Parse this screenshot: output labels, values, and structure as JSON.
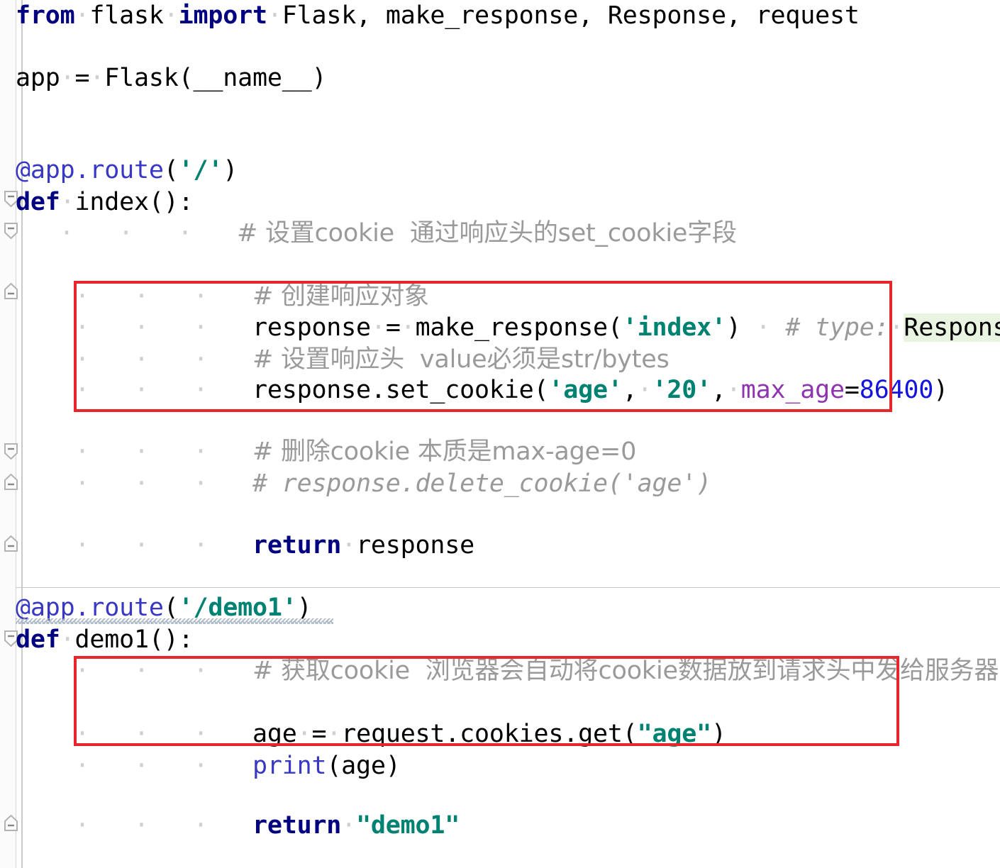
{
  "editor": {
    "language": "python",
    "filename_context": "flask cookie demo",
    "background": "#ffffff",
    "gutter_background": "#fbfbfb",
    "annotation_color": "#e8252b",
    "highlight_background": "#e9f4e1"
  },
  "code_lines": [
    {
      "id": "line-1",
      "text": "from flask import Flask, make_response, Response, request",
      "tokens": [
        {
          "t": "from",
          "c": "kw"
        },
        {
          "t": " ",
          "c": "dot"
        },
        {
          "t": "flask",
          "c": "plain"
        },
        {
          "t": " ",
          "c": "dot"
        },
        {
          "t": "import",
          "c": "kw"
        },
        {
          "t": " ",
          "c": "dot"
        },
        {
          "t": "Flask, make_response, Response, request",
          "c": "plain"
        }
      ]
    },
    {
      "id": "line-3",
      "text": "app = Flask(__name__)",
      "tokens": [
        {
          "t": "app",
          "c": "plain"
        },
        {
          "t": " ",
          "c": "dot"
        },
        {
          "t": "=",
          "c": "plain"
        },
        {
          "t": " ",
          "c": "dot"
        },
        {
          "t": "Flask(__name__)",
          "c": "plain"
        }
      ]
    },
    {
      "id": "line-6",
      "text": "@app.route('/')",
      "tokens": [
        {
          "t": "@app",
          "c": "deco"
        },
        {
          "t": ".",
          "c": "decodot"
        },
        {
          "t": "route",
          "c": "deco"
        },
        {
          "t": "(",
          "c": "plain"
        },
        {
          "t": "'/'",
          "c": "str"
        },
        {
          "t": ")",
          "c": "plain"
        }
      ]
    },
    {
      "id": "line-7",
      "text": "def index():",
      "tokens": [
        {
          "t": "def",
          "c": "kw"
        },
        {
          "t": " ",
          "c": "dot"
        },
        {
          "t": "index():",
          "c": "plain"
        }
      ]
    },
    {
      "id": "line-8",
      "text": "    # 设置cookie  通过响应头的set_cookie字段",
      "comment": true
    },
    {
      "id": "line-10",
      "text": "    # 创建响应对象",
      "comment": true
    },
    {
      "id": "line-11",
      "text": "    response = make_response('index')  # type: Response"
    },
    {
      "id": "line-12",
      "text": "    # 设置响应头  value必须是str/bytes",
      "comment": true
    },
    {
      "id": "line-13",
      "text": "    response.set_cookie('age', '20', max_age=86400)"
    },
    {
      "id": "line-15",
      "text": "    # 删除cookie 本质是max-age=0",
      "comment": true
    },
    {
      "id": "line-16",
      "text": "    # response.delete_cookie('age')",
      "comment": true
    },
    {
      "id": "line-18",
      "text": "    return response"
    },
    {
      "id": "line-20",
      "text": "@app.route('/demo1')"
    },
    {
      "id": "line-21",
      "text": "def demo1():"
    },
    {
      "id": "line-22",
      "text": "    # 获取cookie  浏览器会自动将cookie数据放到请求头中发给服务器",
      "comment": true
    },
    {
      "id": "line-24",
      "text": "    age = request.cookies.get(\"age\")"
    },
    {
      "id": "line-25",
      "text": "    print(age)"
    },
    {
      "id": "line-27",
      "text": "    return \"demo1\""
    }
  ],
  "text": {
    "kw_from": "from",
    "kw_import": "import",
    "kw_def": "def",
    "kw_return": "return",
    "mod_flask": "flask",
    "imports": "Flask, make_response, Response, request",
    "app_assign": "app",
    "eq": "=",
    "flask_ctor": "Flask(__name__)",
    "deco_app": "@app",
    "deco_sep": ".",
    "deco_route": "route",
    "paren_open": "(",
    "paren_close": ")",
    "str_root": "'/'",
    "str_demo1_route": "'/demo1'",
    "fn_index": "index():",
    "fn_demo1": "demo1():",
    "comment_set_cookie": "# 设置cookie  通过响应头的set_cookie字段",
    "comment_create_response": "# 创建响应对象",
    "response_var": "response",
    "make_response_call": "make_response(",
    "str_index": "'index'",
    "comment_type": "# type:",
    "type_response": "Response",
    "comment_set_header": "# 设置响应头  value必须是str/bytes",
    "set_cookie_call": "response.set_cookie(",
    "str_age": "'age'",
    "comma": ",",
    "str_20": "'20'",
    "kwarg_max_age": "max_age",
    "num_86400": "86400",
    "comment_delete_cookie": "# 删除cookie 本质是max-age=0",
    "comment_delete_cookie_code": "# response.delete_cookie('age')",
    "return_response": "response",
    "comment_get_cookie": "# 获取cookie  浏览器会自动将cookie数据放到请求头中发给服务器",
    "age_var": "age",
    "request_cookies_get": "request.cookies.get(",
    "str_age_dq": "\"age\"",
    "builtin_print": "print",
    "print_arg": "(age)",
    "str_demo1": "\"demo1\""
  },
  "annotations": [
    {
      "id": "redbox-1",
      "label": "set-cookie-block",
      "color": "#e8252b"
    },
    {
      "id": "redbox-2",
      "label": "get-cookie-block",
      "color": "#e8252b"
    }
  ]
}
